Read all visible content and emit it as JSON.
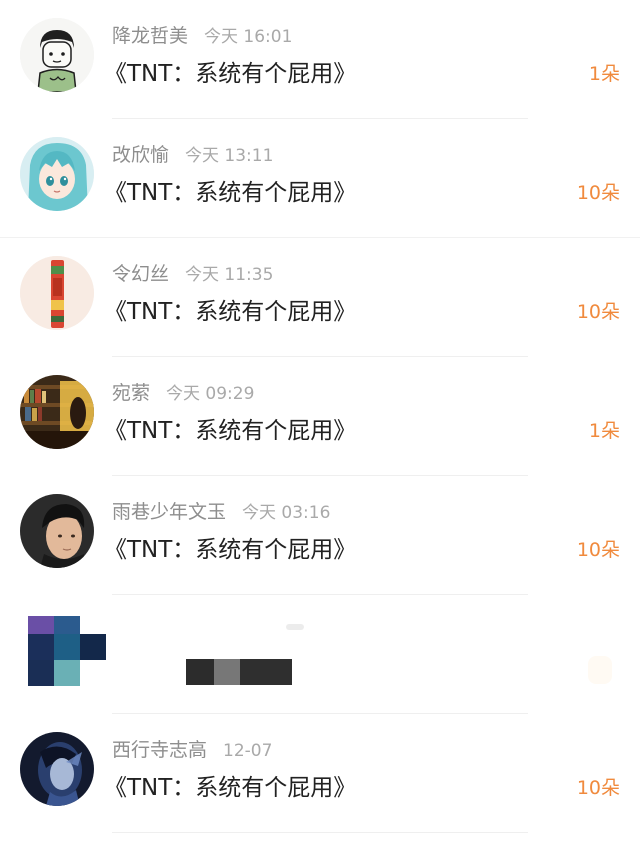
{
  "comments": [
    {
      "name": "降龙哲美",
      "time": "今天 16:01",
      "text": "《TNT：系统有个屁用》",
      "count": "1朵",
      "avatar": "cartoon-boy"
    },
    {
      "name": "改欣愉",
      "time": "今天 13:11",
      "text": "《TNT：系统有个屁用》",
      "count": "10朵",
      "avatar": "anime-girl"
    },
    {
      "name": "令幻丝",
      "time": "今天 11:35",
      "text": "《TNT：系统有个屁用》",
      "count": "10朵",
      "avatar": "red-bookmark"
    },
    {
      "name": "宛萦",
      "time": "今天 09:29",
      "text": "《TNT：系统有个屁用》",
      "count": "1朵",
      "avatar": "bookstore"
    },
    {
      "name": "雨巷少年文玉",
      "time": "今天 03:16",
      "text": "《TNT：系统有个屁用》",
      "count": "10朵",
      "avatar": "man-portrait"
    },
    {
      "name": "西行寺志高",
      "time": "12-07",
      "text": "《TNT：系统有个屁用》",
      "count": "10朵",
      "avatar": "blue-figure"
    }
  ],
  "colors": {
    "count": "#f08a3d",
    "name": "#8e8e8e",
    "time": "#a9a9a9",
    "text": "#222222",
    "divider": "#efefef"
  }
}
